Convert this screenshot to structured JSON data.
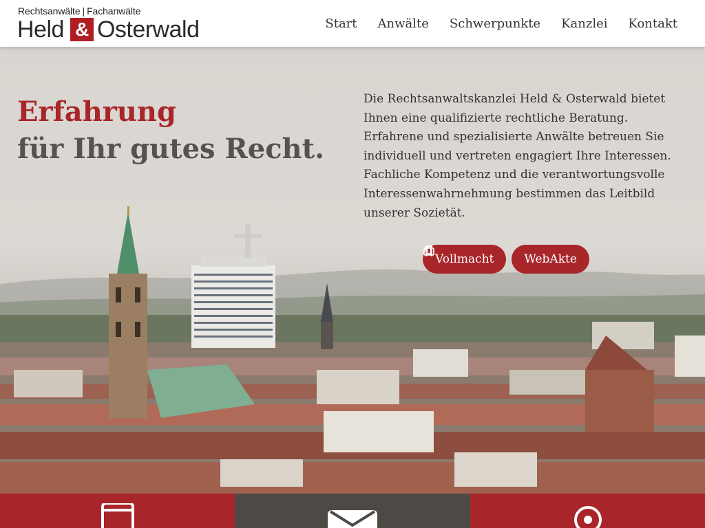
{
  "header": {
    "logo": {
      "tagline_left": "Rechtsanwälte",
      "tagline_sep": "|",
      "tagline_right": "Fachanwälte",
      "name_left": "Held",
      "name_amp": "&",
      "name_right": "Osterwald"
    },
    "nav": [
      "Start",
      "Anwälte",
      "Schwerpunkte",
      "Kanzlei",
      "Kontakt"
    ]
  },
  "hero": {
    "headline_accent": "Erfahrung",
    "headline_main": "für Ihr gutes Recht.",
    "intro": "Die Rechtsanwaltskanzlei Held & Osterwald bietet Ihnen eine qualifizierte rechtliche Beratung. Erfahrene und spezialisierte Anwälte betreuen Sie individuell und vertreten engagiert Ihre Interessen. Fachliche Kompetenz und die verantwortungsvolle Interessenwahrnehmung bestimmen das Leitbild unserer Sozietät.",
    "buttons": [
      {
        "label": "Vollmacht",
        "icon": "bookmark-icon"
      },
      {
        "label": "WebAkte",
        "icon": "briefcase-icon"
      }
    ]
  },
  "features": [
    {
      "icon": "tablet-icon"
    },
    {
      "icon": "envelope-icon"
    },
    {
      "icon": "location-pin-icon"
    }
  ],
  "colors": {
    "accent": "#a8262a",
    "dark": "#4d4a46",
    "text": "#333333"
  }
}
